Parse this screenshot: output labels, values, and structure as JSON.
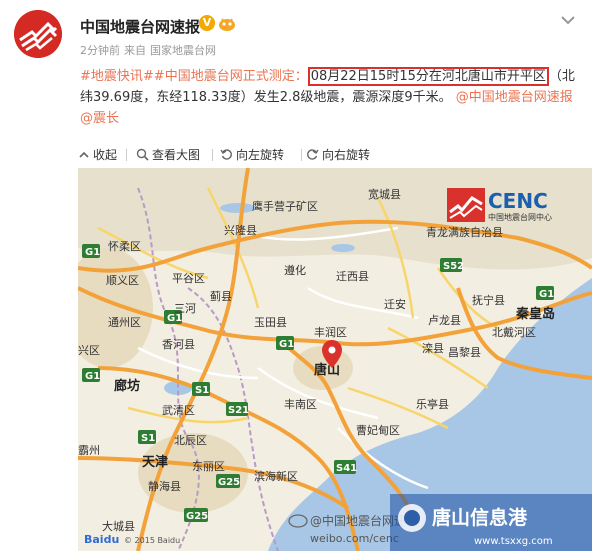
{
  "account": {
    "name": "中国地震台网速报",
    "time": "2分钟前",
    "source_prefix": "来自",
    "source": "国家地震台网"
  },
  "post": {
    "tag1": "#地震快讯#",
    "tag2": "#中国地震台网正式测定：",
    "highlight": "08月22日15时15分在河北唐山市开平区",
    "rest": "（北纬39.69度，东经118.33度）发生2.8级地震，震源深度9千米。",
    "mention1": "@中国地震台网速报",
    "mention2": "@震长"
  },
  "toolbar": {
    "collapse": "收起",
    "view_large": "查看大图",
    "rotate_left": "向左旋转",
    "rotate_right": "向右旋转"
  },
  "map": {
    "logo_text": "CENC",
    "logo_sub": "中国地震台网中心",
    "labels": {
      "kuancheng": "宽城县",
      "yingshouying": "鹰手营子矿区",
      "xinglong": "兴隆县",
      "huairou": "怀柔区",
      "qinglong": "青龙满族自治县",
      "shunyi": "顺义区",
      "pinggu": "平谷区",
      "jixian": "蓟县",
      "zunhua": "遵化",
      "qianxi": "迁西县",
      "qianan": "迁安",
      "lulong": "卢龙县",
      "funing": "抚宁县",
      "qinhuangdao": "秦皇岛",
      "beidaihe": "北戴河区",
      "tongzhou": "通州区",
      "yutian": "玉田县",
      "sanhe": "三河",
      "xianghe": "香河县",
      "fengrun": "丰润区",
      "luanxian": "滦县",
      "changli": "昌黎县",
      "xingqu": "兴区",
      "tangshan": "唐山",
      "langfang": "廊坊",
      "wuqing": "武清区",
      "fengnan": "丰南区",
      "laoting": "乐亭县",
      "caofeidian": "曹妃甸区",
      "beichen": "北辰区",
      "tianjin": "天津",
      "dongli": "东丽区",
      "binhai": "滨海新区",
      "bazhou": "霸州",
      "jinghai": "静海县",
      "dacheng": "大城县"
    },
    "roads": [
      "G1",
      "S52",
      "G1",
      "G1",
      "S1",
      "S21",
      "G25",
      "G1",
      "G1",
      "S41",
      "G25",
      "S1"
    ],
    "watermark": "@中国地震台网速报",
    "watermark_url": "weibo.com/cenc",
    "baidu": "Baidu",
    "copyright": "© 2015 Baidu"
  },
  "corner_watermark": {
    "title": "唐山信息港",
    "url": "www.tsxxg.com"
  }
}
